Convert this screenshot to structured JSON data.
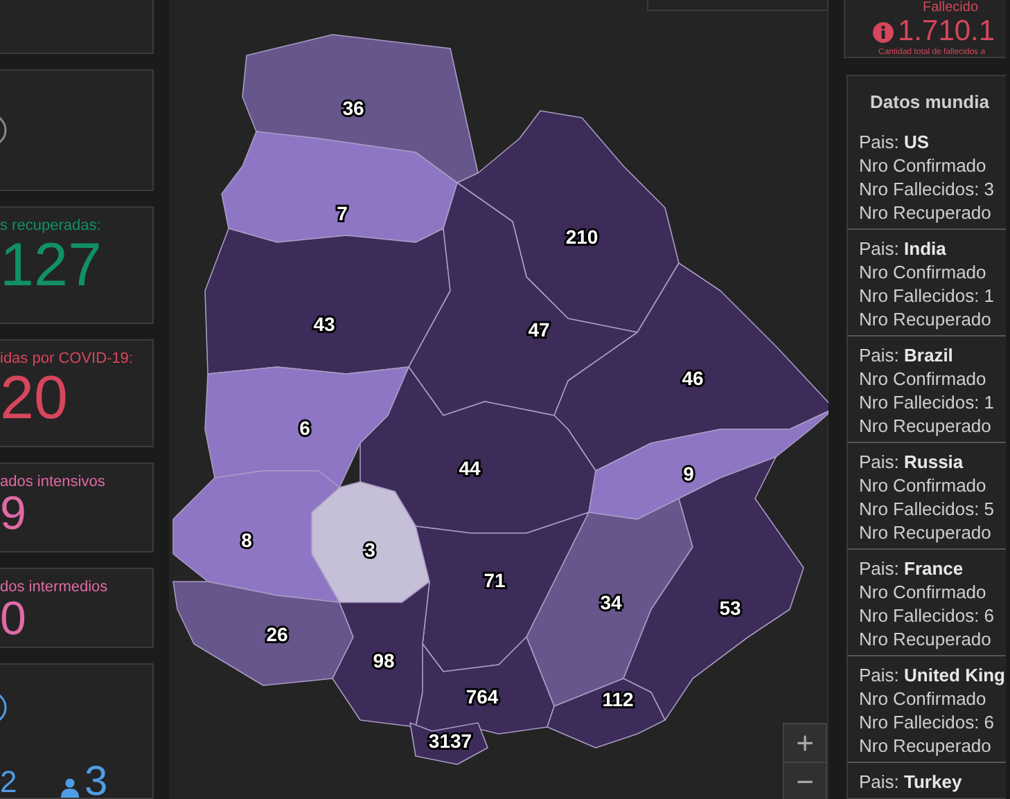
{
  "left_cards": [
    {
      "kind": "blank"
    },
    {
      "kind": "ring",
      "color": "#8a8a8a"
    },
    {
      "kind": "stat",
      "label": "s recuperadas:",
      "value": "127",
      "color": "#119163"
    },
    {
      "kind": "stat",
      "label": "idas por COVID-19:",
      "value": "20",
      "color": "#d6465c"
    },
    {
      "kind": "stat",
      "label": "ados intensivos",
      "value": "9",
      "color": "#e06aa6"
    },
    {
      "kind": "stat",
      "label": "dos intermedios",
      "value": "0",
      "color": "#e06aa6"
    },
    {
      "kind": "people",
      "value_1": "2",
      "value_2": "3",
      "color": "#4f9de6"
    }
  ],
  "top_stat": {
    "label": "Fallecido",
    "value": "1.710.1",
    "caption": "Cantidad total de fallecidos a"
  },
  "map": {
    "regions": [
      {
        "label": "36",
        "color": "#66568c"
      },
      {
        "label": "7",
        "color": "#8f76c4"
      },
      {
        "label": "210",
        "color": "#3d2b59"
      },
      {
        "label": "43",
        "color": "#3d2b59"
      },
      {
        "label": "47",
        "color": "#3d2b59"
      },
      {
        "label": "46",
        "color": "#3d2b59"
      },
      {
        "label": "6",
        "color": "#8f76c4"
      },
      {
        "label": "44",
        "color": "#3d2b59"
      },
      {
        "label": "9",
        "color": "#8f76c4"
      },
      {
        "label": "8",
        "color": "#8f76c4"
      },
      {
        "label": "3",
        "color": "#c5bfd8"
      },
      {
        "label": "71",
        "color": "#3d2b59"
      },
      {
        "label": "34",
        "color": "#66568c"
      },
      {
        "label": "53",
        "color": "#3d2b59"
      },
      {
        "label": "26",
        "color": "#66568c"
      },
      {
        "label": "98",
        "color": "#3d2b59"
      },
      {
        "label": "764",
        "color": "#3d2b59"
      },
      {
        "label": "112",
        "color": "#3d2b59"
      },
      {
        "label": "3137",
        "color": "#3d2b59"
      }
    ],
    "zoom_in": "+",
    "zoom_out": "−"
  },
  "world": {
    "title": "Datos mundia",
    "countries": [
      {
        "prefix": "Pais: ",
        "name": "US",
        "confirmed": "Nro Confirmado",
        "deaths": "Nro Fallecidos: 3",
        "recovered": "Nro Recuperado"
      },
      {
        "prefix": "Pais: ",
        "name": "India",
        "confirmed": "Nro Confirmado",
        "deaths": "Nro Fallecidos: 1",
        "recovered": "Nro Recuperado"
      },
      {
        "prefix": "Pais: ",
        "name": "Brazil",
        "confirmed": "Nro Confirmado",
        "deaths": "Nro Fallecidos: 1",
        "recovered": "Nro Recuperado"
      },
      {
        "prefix": "Pais: ",
        "name": "Russia",
        "confirmed": "Nro Confirmado",
        "deaths": "Nro Fallecidos: 5",
        "recovered": "Nro Recuperado"
      },
      {
        "prefix": "Pais: ",
        "name": "France",
        "confirmed": "Nro Confirmado",
        "deaths": "Nro Fallecidos: 6",
        "recovered": "Nro Recuperado"
      },
      {
        "prefix": "Pais: ",
        "name": "United King",
        "confirmed": "Nro Confirmado",
        "deaths": "Nro Fallecidos: 6",
        "recovered": "Nro Recuperado"
      },
      {
        "prefix": "Pais: ",
        "name": "Turkey"
      }
    ]
  }
}
